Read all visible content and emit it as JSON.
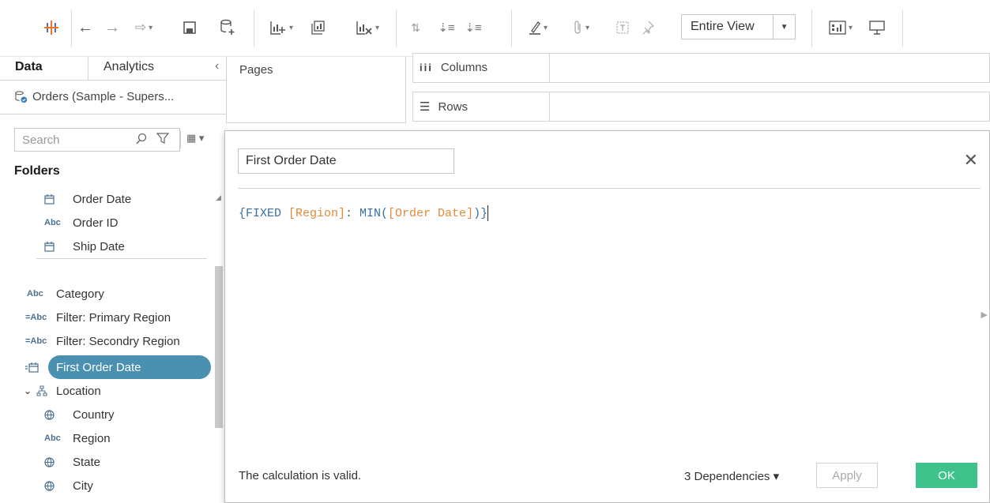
{
  "toolbar": {
    "view_select": "Entire View",
    "icons": [
      "tableau-logo-icon",
      "back-icon",
      "forward-icon",
      "redo-icon",
      "save-icon",
      "new-datasource-icon",
      "new-worksheet-icon",
      "duplicate-sheet-icon",
      "clear-sheet-icon",
      "swap-icon",
      "sort-asc-icon",
      "sort-desc-icon",
      "highlight-icon",
      "attach-icon",
      "label-icon",
      "pin-icon",
      "show-me-icon",
      "presentation-icon"
    ]
  },
  "sidebar": {
    "tabs": [
      "Data",
      "Analytics"
    ],
    "datasource": "Orders (Sample - Supers...",
    "search_placeholder": "Search",
    "folders_label": "Folders",
    "fields": [
      {
        "label": "Order Date",
        "type": "date"
      },
      {
        "label": "Order ID",
        "type": "Abc"
      },
      {
        "label": "Ship Date",
        "type": "date"
      },
      {
        "label": "Category",
        "type": "Abc"
      },
      {
        "label": "Filter: Primary Region",
        "type": "=Abc"
      },
      {
        "label": "Filter: Secondry Region",
        "type": "=Abc"
      },
      {
        "label": "First Order Date",
        "type": "=date",
        "selected": true
      },
      {
        "label": "Location",
        "type": "hierarchy"
      },
      {
        "label": "Country",
        "type": "geo"
      },
      {
        "label": "Region",
        "type": "Abc"
      },
      {
        "label": "State",
        "type": "geo"
      },
      {
        "label": "City",
        "type": "geo"
      }
    ]
  },
  "shelves": {
    "pages": "Pages",
    "columns": "Columns",
    "rows": "Rows"
  },
  "dialog": {
    "name": "First Order Date",
    "formula": {
      "open": "{FIXED ",
      "field1": "[Region]",
      "mid": ": MIN(",
      "field2": "[Order Date]",
      "close": ")}"
    },
    "status": "The calculation is valid.",
    "dependencies": "3 Dependencies ▾",
    "apply_label": "Apply",
    "ok_label": "OK"
  },
  "colors": {
    "selection": "#4a90b0",
    "ok_button": "#3fc28b",
    "keyword": "#3a6fa0",
    "field_ref": "#e08a3c"
  }
}
